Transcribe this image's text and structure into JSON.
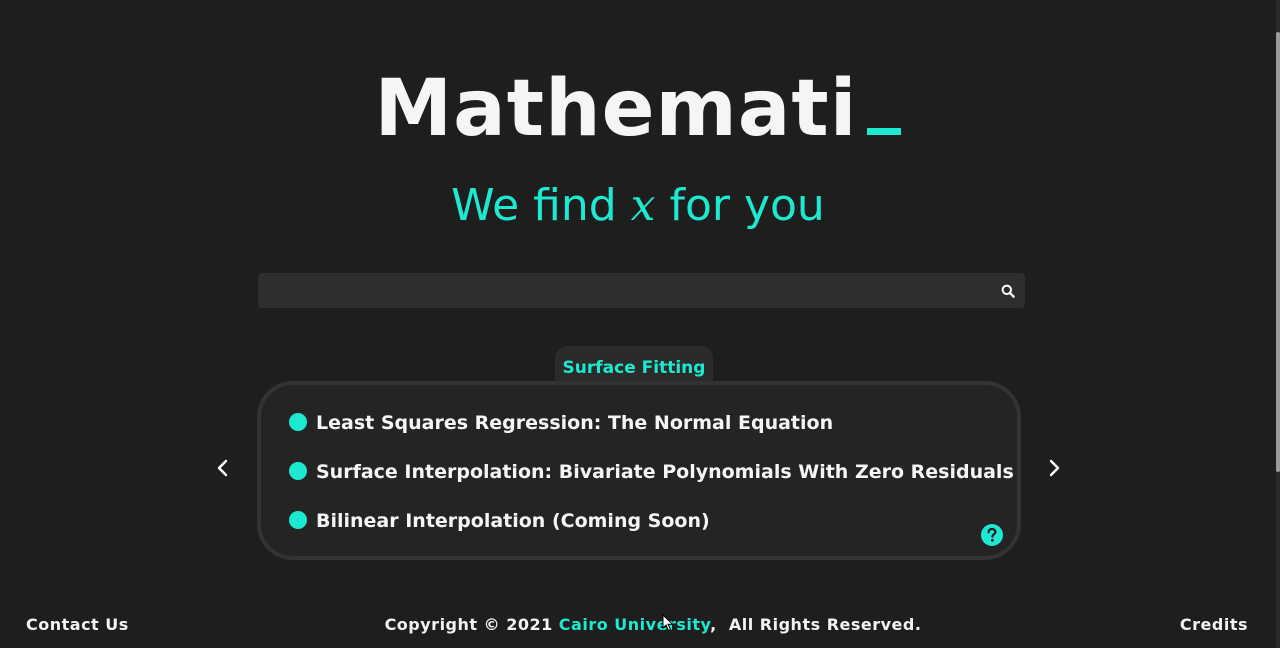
{
  "header": {
    "brand": "Mathemati",
    "tagline_before": "We find ",
    "tagline_var": "x",
    "tagline_after": " for you"
  },
  "search": {
    "value": "",
    "placeholder": "",
    "icon": "search-icon"
  },
  "category": {
    "title": "Surface Fitting",
    "items": [
      "Least Squares Regression: The Normal Equation",
      "Surface Interpolation: Bivariate Polynomials With Zero Residuals",
      "Bilinear Interpolation (Coming Soon)"
    ],
    "prev_icon": "chevron-left-icon",
    "next_icon": "chevron-right-icon",
    "help_icon": "help-icon"
  },
  "footer": {
    "contact": "Contact Us",
    "copyright_prefix": "Copyright © 2021 ",
    "university": "Cairo University",
    "copyright_suffix": ",  All Rights Reserved.",
    "credits": "Credits"
  },
  "colors": {
    "accent": "#1de9d0",
    "background": "#1e1e1e",
    "card": "#242424"
  }
}
